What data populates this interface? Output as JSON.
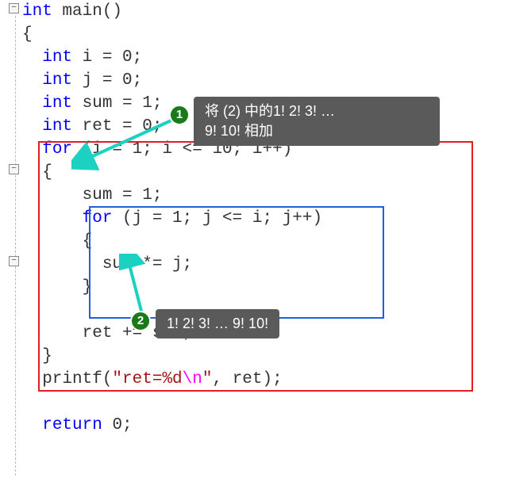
{
  "code": {
    "l1_int": "int",
    "l1_main": " main()",
    "l2": "{",
    "l3": "  ",
    "l3_int": "int",
    "l3_rest": " i = 0;",
    "l4": "  ",
    "l4_int": "int",
    "l4_rest": " j = 0;",
    "l5": "  ",
    "l5_int": "int",
    "l5_rest": " sum = 1;",
    "l6": "  ",
    "l6_int": "int",
    "l6_rest": " ret = 0;",
    "l7": "  ",
    "l7_for": "for",
    "l7_rest": " (i = 1; i <= 10; i++)",
    "l8": "  {",
    "l9": "      sum = 1;",
    "l10": "      ",
    "l10_for": "for",
    "l10_rest": " (j = 1; j <= i; j++)",
    "l11": "      {",
    "l12": "        sum *= j;",
    "l13": "      }",
    "l14": "",
    "l15": "      ret += sum;",
    "l16": "  }",
    "l17": "  printf(",
    "l17_q1": "\"",
    "l17_s1": "ret=%d",
    "l17_esc": "\\n",
    "l17_q2": "\"",
    "l17_rest": ", ret);",
    "l18": "",
    "l19": "  ",
    "l19_ret": "return",
    "l19_rest": " 0;"
  },
  "callout1": "将  (2)  中的1!  2!  3!  …\n9!  10!  相加",
  "callout2": "1!  2!  3!  … 9!  10!",
  "badge1": "1",
  "badge2": "2",
  "fold_minus": "−",
  "colors": {
    "callout_bg": "#5a5a5a",
    "badge_bg": "#1a7a1a",
    "arrow": "#1dd1c1"
  }
}
